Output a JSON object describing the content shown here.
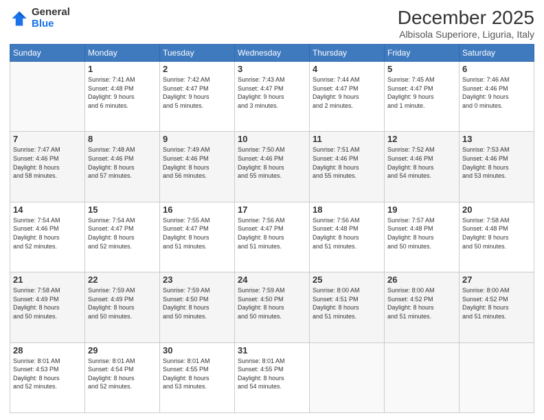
{
  "logo": {
    "general": "General",
    "blue": "Blue"
  },
  "header": {
    "month": "December 2025",
    "location": "Albisola Superiore, Liguria, Italy"
  },
  "weekdays": [
    "Sunday",
    "Monday",
    "Tuesday",
    "Wednesday",
    "Thursday",
    "Friday",
    "Saturday"
  ],
  "weeks": [
    [
      {
        "day": "",
        "info": ""
      },
      {
        "day": "1",
        "info": "Sunrise: 7:41 AM\nSunset: 4:48 PM\nDaylight: 9 hours\nand 6 minutes."
      },
      {
        "day": "2",
        "info": "Sunrise: 7:42 AM\nSunset: 4:47 PM\nDaylight: 9 hours\nand 5 minutes."
      },
      {
        "day": "3",
        "info": "Sunrise: 7:43 AM\nSunset: 4:47 PM\nDaylight: 9 hours\nand 3 minutes."
      },
      {
        "day": "4",
        "info": "Sunrise: 7:44 AM\nSunset: 4:47 PM\nDaylight: 9 hours\nand 2 minutes."
      },
      {
        "day": "5",
        "info": "Sunrise: 7:45 AM\nSunset: 4:47 PM\nDaylight: 9 hours\nand 1 minute."
      },
      {
        "day": "6",
        "info": "Sunrise: 7:46 AM\nSunset: 4:46 PM\nDaylight: 9 hours\nand 0 minutes."
      }
    ],
    [
      {
        "day": "7",
        "info": "Sunrise: 7:47 AM\nSunset: 4:46 PM\nDaylight: 8 hours\nand 58 minutes."
      },
      {
        "day": "8",
        "info": "Sunrise: 7:48 AM\nSunset: 4:46 PM\nDaylight: 8 hours\nand 57 minutes."
      },
      {
        "day": "9",
        "info": "Sunrise: 7:49 AM\nSunset: 4:46 PM\nDaylight: 8 hours\nand 56 minutes."
      },
      {
        "day": "10",
        "info": "Sunrise: 7:50 AM\nSunset: 4:46 PM\nDaylight: 8 hours\nand 55 minutes."
      },
      {
        "day": "11",
        "info": "Sunrise: 7:51 AM\nSunset: 4:46 PM\nDaylight: 8 hours\nand 55 minutes."
      },
      {
        "day": "12",
        "info": "Sunrise: 7:52 AM\nSunset: 4:46 PM\nDaylight: 8 hours\nand 54 minutes."
      },
      {
        "day": "13",
        "info": "Sunrise: 7:53 AM\nSunset: 4:46 PM\nDaylight: 8 hours\nand 53 minutes."
      }
    ],
    [
      {
        "day": "14",
        "info": "Sunrise: 7:54 AM\nSunset: 4:46 PM\nDaylight: 8 hours\nand 52 minutes."
      },
      {
        "day": "15",
        "info": "Sunrise: 7:54 AM\nSunset: 4:47 PM\nDaylight: 8 hours\nand 52 minutes."
      },
      {
        "day": "16",
        "info": "Sunrise: 7:55 AM\nSunset: 4:47 PM\nDaylight: 8 hours\nand 51 minutes."
      },
      {
        "day": "17",
        "info": "Sunrise: 7:56 AM\nSunset: 4:47 PM\nDaylight: 8 hours\nand 51 minutes."
      },
      {
        "day": "18",
        "info": "Sunrise: 7:56 AM\nSunset: 4:48 PM\nDaylight: 8 hours\nand 51 minutes."
      },
      {
        "day": "19",
        "info": "Sunrise: 7:57 AM\nSunset: 4:48 PM\nDaylight: 8 hours\nand 50 minutes."
      },
      {
        "day": "20",
        "info": "Sunrise: 7:58 AM\nSunset: 4:48 PM\nDaylight: 8 hours\nand 50 minutes."
      }
    ],
    [
      {
        "day": "21",
        "info": "Sunrise: 7:58 AM\nSunset: 4:49 PM\nDaylight: 8 hours\nand 50 minutes."
      },
      {
        "day": "22",
        "info": "Sunrise: 7:59 AM\nSunset: 4:49 PM\nDaylight: 8 hours\nand 50 minutes."
      },
      {
        "day": "23",
        "info": "Sunrise: 7:59 AM\nSunset: 4:50 PM\nDaylight: 8 hours\nand 50 minutes."
      },
      {
        "day": "24",
        "info": "Sunrise: 7:59 AM\nSunset: 4:50 PM\nDaylight: 8 hours\nand 50 minutes."
      },
      {
        "day": "25",
        "info": "Sunrise: 8:00 AM\nSunset: 4:51 PM\nDaylight: 8 hours\nand 51 minutes."
      },
      {
        "day": "26",
        "info": "Sunrise: 8:00 AM\nSunset: 4:52 PM\nDaylight: 8 hours\nand 51 minutes."
      },
      {
        "day": "27",
        "info": "Sunrise: 8:00 AM\nSunset: 4:52 PM\nDaylight: 8 hours\nand 51 minutes."
      }
    ],
    [
      {
        "day": "28",
        "info": "Sunrise: 8:01 AM\nSunset: 4:53 PM\nDaylight: 8 hours\nand 52 minutes."
      },
      {
        "day": "29",
        "info": "Sunrise: 8:01 AM\nSunset: 4:54 PM\nDaylight: 8 hours\nand 52 minutes."
      },
      {
        "day": "30",
        "info": "Sunrise: 8:01 AM\nSunset: 4:55 PM\nDaylight: 8 hours\nand 53 minutes."
      },
      {
        "day": "31",
        "info": "Sunrise: 8:01 AM\nSunset: 4:55 PM\nDaylight: 8 hours\nand 54 minutes."
      },
      {
        "day": "",
        "info": ""
      },
      {
        "day": "",
        "info": ""
      },
      {
        "day": "",
        "info": ""
      }
    ]
  ]
}
